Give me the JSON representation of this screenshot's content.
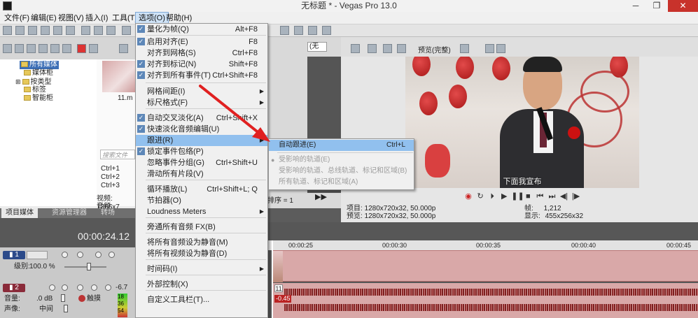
{
  "window": {
    "title": "无标题 * - Vegas Pro 13.0",
    "minimize": "─",
    "maximize": "❐",
    "close": "✕"
  },
  "menubar": [
    {
      "label": "文件(F)"
    },
    {
      "label": "编辑(E)"
    },
    {
      "label": "视图(V)"
    },
    {
      "label": "插入(I)"
    },
    {
      "label": "工具(T)"
    },
    {
      "label": "选项(O)"
    },
    {
      "label": "帮助(H)"
    }
  ],
  "explorer": {
    "tree": [
      "所有媒体",
      "媒体柜",
      "按类型",
      "标签",
      "智能柜"
    ],
    "thumb_name": "11.m",
    "search_placeholder": "搜索文件",
    "shortcuts": [
      "Ctrl+1",
      "Ctrl+2",
      "Ctrl+3"
    ],
    "info": [
      "视频: 1366x7",
      "音频: 48,000"
    ],
    "tabs": [
      "项目媒体",
      "资源管理器",
      "转场"
    ]
  },
  "timecode": "00:00:24.12",
  "track1": {
    "level_label": "级别:",
    "level_value": "100.0 %"
  },
  "track2": {
    "vol_label": "音量:",
    "vol_value": ".0 dB",
    "pan_label": "声像:",
    "pan_value": "中间",
    "mode": "触摸",
    "meter": [
      "18",
      "36",
      "54"
    ],
    "level": "-6.7"
  },
  "mid": {
    "select_value": "(无",
    "sort_text": "排序 = 1"
  },
  "preview": {
    "mode_label": "预览(完整)",
    "subtitle": "下面我宣布",
    "project": "项目: 1280x720x32, 50.000p",
    "preview": "预览: 1280x720x32, 50.000p",
    "frame_label": "帧:",
    "frame_value": "1,212",
    "display_label": "显示:",
    "display_value": "455x256x32",
    "transport_icons": [
      "record-icon",
      "loop-icon",
      "play-from-start-icon",
      "play-icon",
      "pause-icon",
      "stop-icon",
      "prev-marker-icon",
      "next-marker-icon",
      "prev-frame-icon",
      "next-frame-icon"
    ]
  },
  "ruler": {
    "marks": [
      "00:00:25",
      "00:00:30",
      "00:00:35",
      "00:00:40",
      "00:00:45"
    ]
  },
  "audio_event": {
    "label": "11",
    "db": "-0.45"
  },
  "options_menu": {
    "items": [
      {
        "label": "量化为帧(Q)",
        "shortcut": "Alt+F8",
        "checked": true
      },
      {
        "label": "启用对齐(E)",
        "shortcut": "F8",
        "checked": true
      },
      {
        "label": "对齐到网格(S)",
        "shortcut": "Ctrl+F8",
        "checked": false
      },
      {
        "label": "对齐到标记(N)",
        "shortcut": "Shift+F8",
        "checked": true
      },
      {
        "label": "对齐到所有事件(T)",
        "shortcut": "Ctrl+Shift+F8",
        "checked": true
      },
      {
        "label": "网格间距(I)",
        "shortcut": "",
        "checked": false,
        "submenu": true
      },
      {
        "label": "标尺格式(F)",
        "shortcut": "",
        "checked": false,
        "submenu": true
      },
      {
        "label": "自动交叉淡化(A)",
        "shortcut": "Ctrl+Shift+X",
        "checked": true
      },
      {
        "label": "快速淡化音频编辑(U)",
        "shortcut": "",
        "checked": true
      },
      {
        "label": "跟进(R)",
        "shortcut": "",
        "checked": false,
        "submenu": true,
        "highlighted": true
      },
      {
        "label": "锁定事件包络(P)",
        "shortcut": "",
        "checked": true
      },
      {
        "label": "忽略事件分组(G)",
        "shortcut": "Ctrl+Shift+U",
        "checked": false
      },
      {
        "label": "滑动所有片段(V)",
        "shortcut": "",
        "checked": false
      },
      {
        "label": "循环播放(L)",
        "shortcut": "Ctrl+Shift+L; Q",
        "checked": false
      },
      {
        "label": "节拍器(O)",
        "shortcut": "",
        "checked": false
      },
      {
        "label": "Loudness Meters",
        "shortcut": "",
        "checked": false,
        "submenu": true
      },
      {
        "label": "旁通所有音频 FX(B)",
        "shortcut": "",
        "checked": false
      },
      {
        "label": "将所有音频设为静音(M)",
        "shortcut": "",
        "checked": false
      },
      {
        "label": "将所有视频设为静音(D)",
        "shortcut": "",
        "checked": false
      },
      {
        "label": "时间码(I)",
        "shortcut": "",
        "checked": false,
        "submenu": true
      },
      {
        "label": "外部控制(X)",
        "shortcut": "",
        "checked": false
      },
      {
        "label": "自定义工具栏(T)...",
        "shortcut": "",
        "checked": false
      }
    ]
  },
  "ripple_submenu": {
    "items": [
      {
        "label": "自动跟进(E)",
        "shortcut": "Ctrl+L",
        "highlighted": true
      },
      {
        "label": "受影响的轨道(E)",
        "disabled": true,
        "radio": true
      },
      {
        "label": "受影响的轨道、总线轨道、标记和区域(B)",
        "disabled": true
      },
      {
        "label": "所有轨道、标记和区域(A)",
        "disabled": true
      }
    ]
  },
  "colors": {
    "menu_highlight": "#91c0ee",
    "check_bg": "#5d87b8",
    "event_bg": "#d9a8a8",
    "waveform": "#8b2a2a",
    "close_button": "#c8322b",
    "arrow": "#e02020"
  }
}
